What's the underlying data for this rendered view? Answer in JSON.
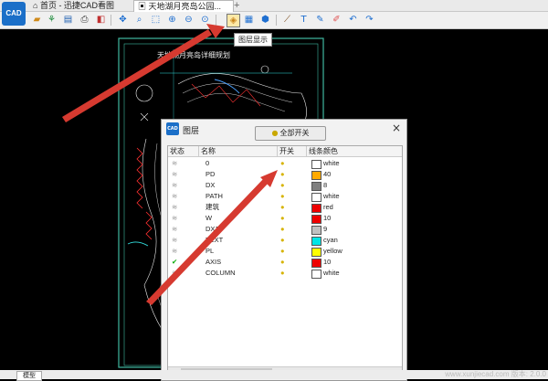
{
  "app": {
    "logo_text": "CAD"
  },
  "tabs": {
    "home": "首页 - 迅捷CAD看图",
    "document": "天地湖月亮岛公园...",
    "new_tab": "+"
  },
  "toolbar": {
    "tooltip": "图层显示"
  },
  "drawing": {
    "title": "天地湖月亮岛详细规划"
  },
  "layer_dialog": {
    "title": "图层",
    "close": "×",
    "toggle_all": "全部开关",
    "columns": {
      "state": "状态",
      "name": "名称",
      "onoff": "开关",
      "line_color": "线条颜色"
    },
    "rows": [
      {
        "state": "≋",
        "active": false,
        "name": "0",
        "color_name": "white",
        "color": "#ffffff"
      },
      {
        "state": "≋",
        "active": false,
        "name": "PD",
        "color_name": "40",
        "color": "#ffaa00"
      },
      {
        "state": "≋",
        "active": false,
        "name": "DX",
        "color_name": "8",
        "color": "#808080"
      },
      {
        "state": "≋",
        "active": false,
        "name": "PATH",
        "color_name": "white",
        "color": "#ffffff"
      },
      {
        "state": "≋",
        "active": false,
        "name": "建筑",
        "color_name": "red",
        "color": "#ee0000"
      },
      {
        "state": "≋",
        "active": false,
        "name": "W",
        "color_name": "10",
        "color": "#ee0000"
      },
      {
        "state": "≋",
        "active": false,
        "name": "DX1",
        "color_name": "9",
        "color": "#c0c0c0"
      },
      {
        "state": "≋",
        "active": false,
        "name": "TEXT",
        "color_name": "cyan",
        "color": "#00e5e5"
      },
      {
        "state": "≋",
        "active": false,
        "name": "PL",
        "color_name": "yellow",
        "color": "#ffff00"
      },
      {
        "state": "✔",
        "active": true,
        "name": "AXIS",
        "color_name": "10",
        "color": "#ee0000"
      },
      {
        "state": "≋",
        "active": false,
        "name": "COLUMN",
        "color_name": "white",
        "color": "#ffffff"
      }
    ]
  },
  "status": {
    "model_tab": "模型",
    "watermark": "www.xunjiecad.com 版本: 2.0.0"
  }
}
